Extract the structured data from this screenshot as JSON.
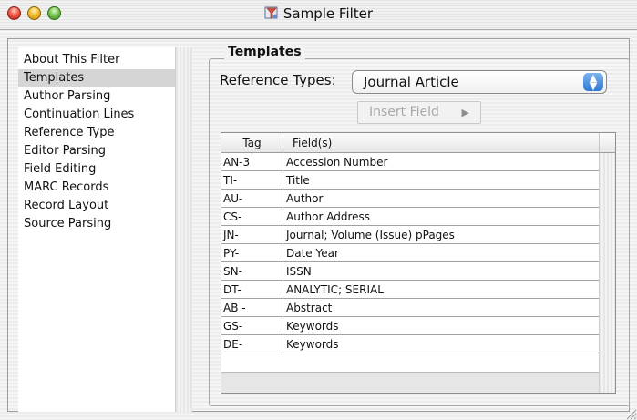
{
  "window": {
    "title": "Sample Filter"
  },
  "sidebar": {
    "items": [
      {
        "label": "About This Filter",
        "selected": false
      },
      {
        "label": "Templates",
        "selected": true
      },
      {
        "label": "Author Parsing",
        "selected": false
      },
      {
        "label": "Continuation Lines",
        "selected": false
      },
      {
        "label": "Reference Type",
        "selected": false
      },
      {
        "label": "Editor Parsing",
        "selected": false
      },
      {
        "label": "Field Editing",
        "selected": false
      },
      {
        "label": "MARC Records",
        "selected": false
      },
      {
        "label": "Record Layout",
        "selected": false
      },
      {
        "label": "Source Parsing",
        "selected": false
      }
    ]
  },
  "templates": {
    "group_title": "Templates",
    "reference_types_label": "Reference Types:",
    "reference_type_value": "Journal Article",
    "insert_field_label": "Insert Field",
    "insert_field_enabled": false
  },
  "table": {
    "columns": [
      "Tag",
      "Field(s)"
    ],
    "rows": [
      {
        "tag": "AN-3",
        "field": "Accession Number"
      },
      {
        "tag": "TI-",
        "field": "Title"
      },
      {
        "tag": "AU-",
        "field": "Author"
      },
      {
        "tag": "CS-",
        "field": "Author Address"
      },
      {
        "tag": "JN-",
        "field": "Journal; Volume (Issue) pPages"
      },
      {
        "tag": "PY-",
        "field": "Date Year"
      },
      {
        "tag": "SN-",
        "field": "ISSN"
      },
      {
        "tag": "DT-",
        "field": "ANALYTIC; SERIAL"
      },
      {
        "tag": "AB -",
        "field": "Abstract"
      },
      {
        "tag": "GS-",
        "field": "Keywords"
      },
      {
        "tag": "DE-",
        "field": "Keywords"
      }
    ]
  },
  "icons": {
    "close": "close-icon",
    "minimize": "minimize-icon",
    "zoom": "zoom-icon",
    "app": "filter-app-icon",
    "popup": "chevron-updown-icon",
    "insert": "triangle-right-icon",
    "resize": "resize-grip-icon"
  },
  "colors": {
    "close": "#ee5a45",
    "minimize": "#f3bb2b",
    "zoom": "#79c451",
    "popup_accent": "#2f78d4",
    "selection": "#d5d5d5"
  }
}
